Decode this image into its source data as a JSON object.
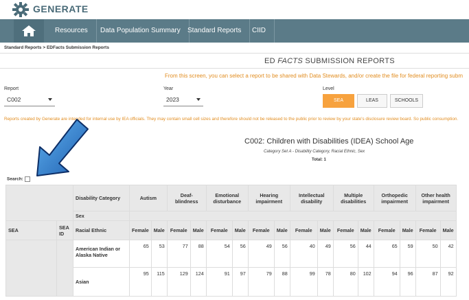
{
  "app": {
    "brand": "GENERATE"
  },
  "nav": {
    "items": [
      "Resources",
      "Data Population Summary",
      "Standard Reports",
      "CIID"
    ]
  },
  "breadcrumb": "Standard Reports > EDFacts Submission Reports",
  "page_title": {
    "prefix": "ED ",
    "em": "FACTS",
    "suffix": " SUBMISSION REPORTS"
  },
  "intro": "From this screen, you can select a report to be shared with Data Stewards, and/or create the file for federal reporting subm",
  "filters": {
    "report_label": "Report",
    "report_value": "C002",
    "year_label": "Year",
    "year_value": "2023",
    "level_label": "Level",
    "levels": [
      "SEA",
      "LEAS",
      "SCHOOLS"
    ],
    "active_level": "SEA"
  },
  "disclaimer": "Reports created by Generate are intended for internal use by IEA officials. They may contain small cell sizes and therefore should not be released to the public prior to review by your state's disclosure review board. So public consumption.",
  "report": {
    "title": "C002: Children with Disabilities (IDEA) School Age",
    "subtitle": "Category Set A - Disability Category, Racial Ethnic, Sex",
    "total": "Total: 1"
  },
  "search": {
    "label": "Search:"
  },
  "table": {
    "sea_label": "SEA",
    "sea_id_label": "SEA ID",
    "row_headers": [
      "Disability Category",
      "Sex",
      "Racial Ethnic"
    ],
    "categories": [
      "Autism",
      "Deaf-blindness",
      "Emotional disturbance",
      "Hearing impairment",
      "Intellectual disability",
      "Multiple disabilities",
      "Orthopedic impairment",
      "Other health impairment"
    ],
    "female": "Female",
    "male": "Male",
    "rows": [
      {
        "race": "American Indian or Alaska Native",
        "values": [
          "65",
          "53",
          "77",
          "88",
          "54",
          "56",
          "49",
          "56",
          "40",
          "49",
          "56",
          "44",
          "65",
          "59",
          "50",
          "42"
        ]
      },
      {
        "race": "Asian",
        "values": [
          "95",
          "115",
          "129",
          "124",
          "91",
          "97",
          "79",
          "88",
          "99",
          "78",
          "80",
          "102",
          "94",
          "96",
          "87",
          "92"
        ]
      }
    ]
  }
}
